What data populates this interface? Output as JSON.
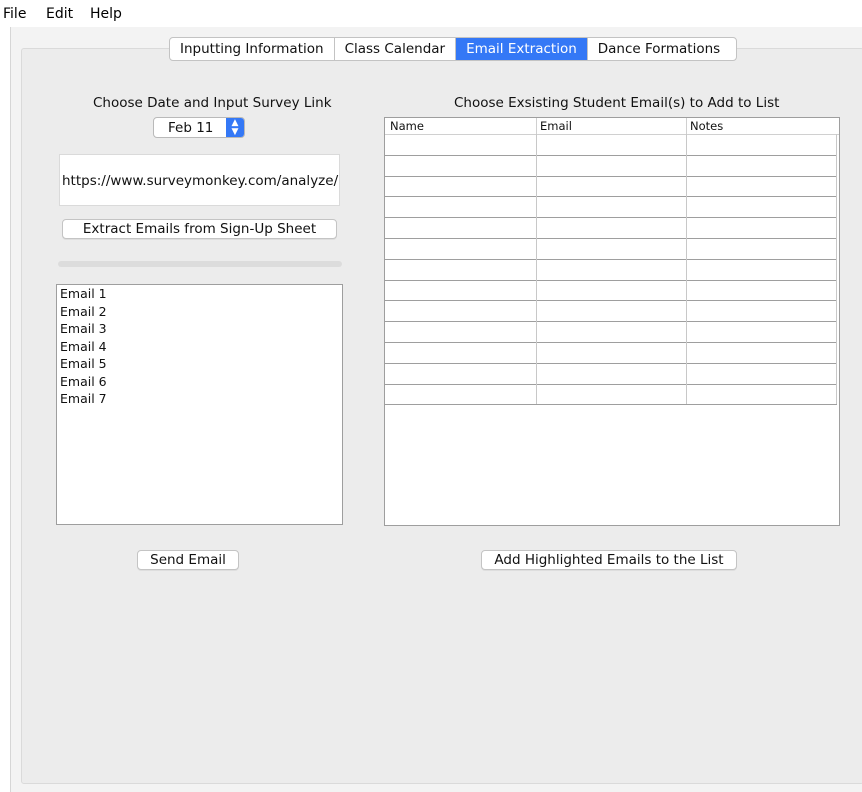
{
  "menu": {
    "file": "File",
    "edit": "Edit",
    "help": "Help"
  },
  "tabs": [
    "Inputting Information",
    "Class Calendar",
    "Email Extraction",
    "Dance Formations"
  ],
  "active_tab": 2,
  "left": {
    "heading": "Choose Date and Input Survey Link",
    "date_value": "Feb 11",
    "survey_link": "https://www.surveymonkey.com/analyze/",
    "extract_button": "Extract Emails from Sign-Up Sheet",
    "progress": 0,
    "emails": [
      "Email 1",
      "Email 2",
      "Email 3",
      "Email 4",
      "Email 5",
      "Email 6",
      "Email 7"
    ],
    "send_button": "Send Email"
  },
  "right": {
    "heading": "Choose Exsisting Student Email(s) to Add to List",
    "columns": [
      "Name",
      "Email",
      "Notes"
    ],
    "add_button": "Add Highlighted Emails to the List"
  },
  "colors": {
    "accent": "#3478f6",
    "panel": "#ececec"
  }
}
